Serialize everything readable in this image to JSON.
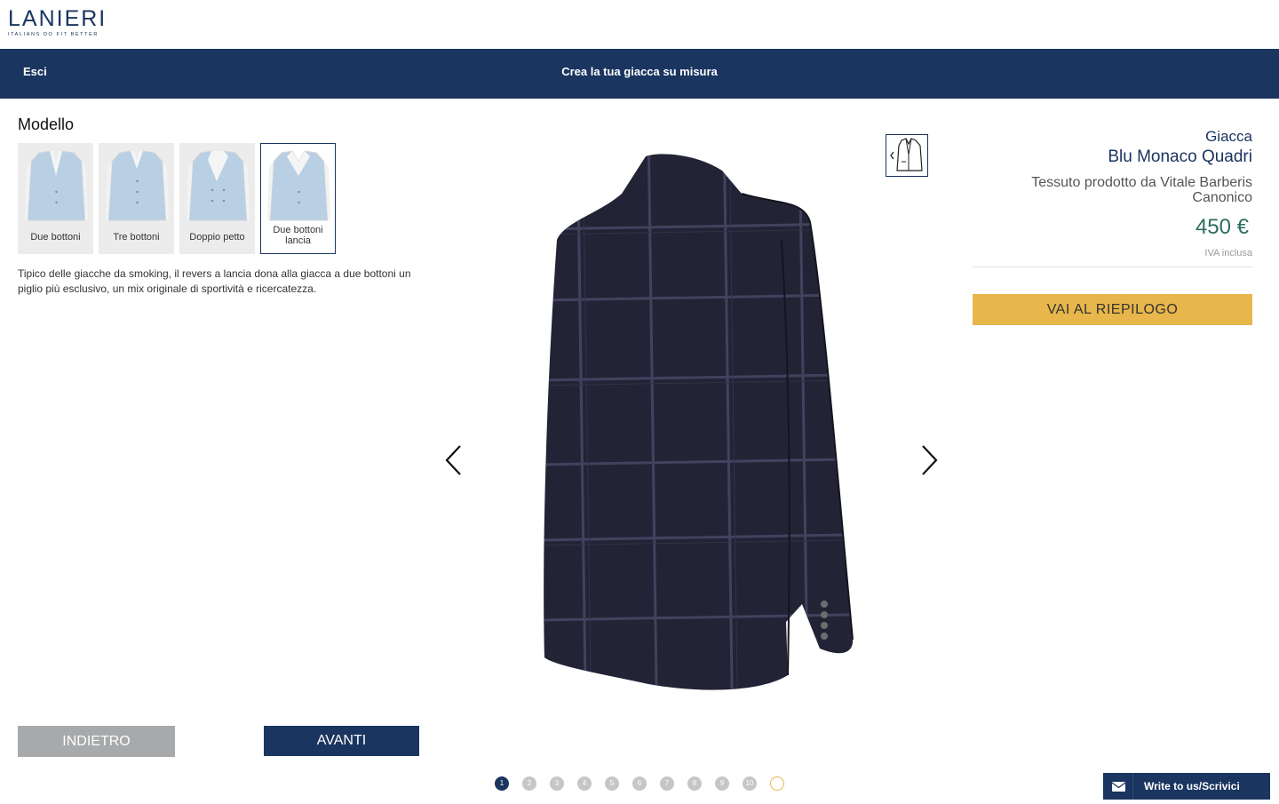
{
  "brand": {
    "name": "LANIERI",
    "tagline": "ITALIANS DO FIT BETTER"
  },
  "nav": {
    "exit_label": "Esci",
    "title": "Crea la tua giacca su misura"
  },
  "config": {
    "section_title": "Modello",
    "models": [
      {
        "label": "Due bottoni",
        "selected": false
      },
      {
        "label": "Tre bottoni",
        "selected": false
      },
      {
        "label": "Doppio petto",
        "selected": false
      },
      {
        "label": "Due bottoni lancia",
        "selected": true
      }
    ],
    "description": "Tipico delle giacche da smoking, il revers a lancia dona alla giacca a due bottoni un piglio più esclusivo, un mix originale di sportività e ricercatezza.",
    "back_label": "INDIETRO",
    "next_label": "AVANTI"
  },
  "viewer": {
    "prev_icon": "chevron-left-icon",
    "next_icon": "chevron-right-icon",
    "toggle_icon": "jacket-front-icon"
  },
  "product": {
    "type": "Giacca",
    "name": "Blu Monaco Quadri",
    "fabric": "Tessuto prodotto da Vitale Barberis Canonico",
    "price": "450 €",
    "vat": "IVA inclusa",
    "summary_label": "VAI AL RIEPILOGO"
  },
  "steps": [
    "1",
    "2",
    "3",
    "4",
    "5",
    "6",
    "7",
    "8",
    "9",
    "10",
    ""
  ],
  "active_step": 1,
  "chat": {
    "label": "Write to us/Scrivici",
    "icon": "envelope-icon"
  },
  "colors": {
    "navy": "#1a3560",
    "gold": "#e8b64a",
    "price_green": "#2b6e5e",
    "grey_button": "#a7a9ab"
  }
}
